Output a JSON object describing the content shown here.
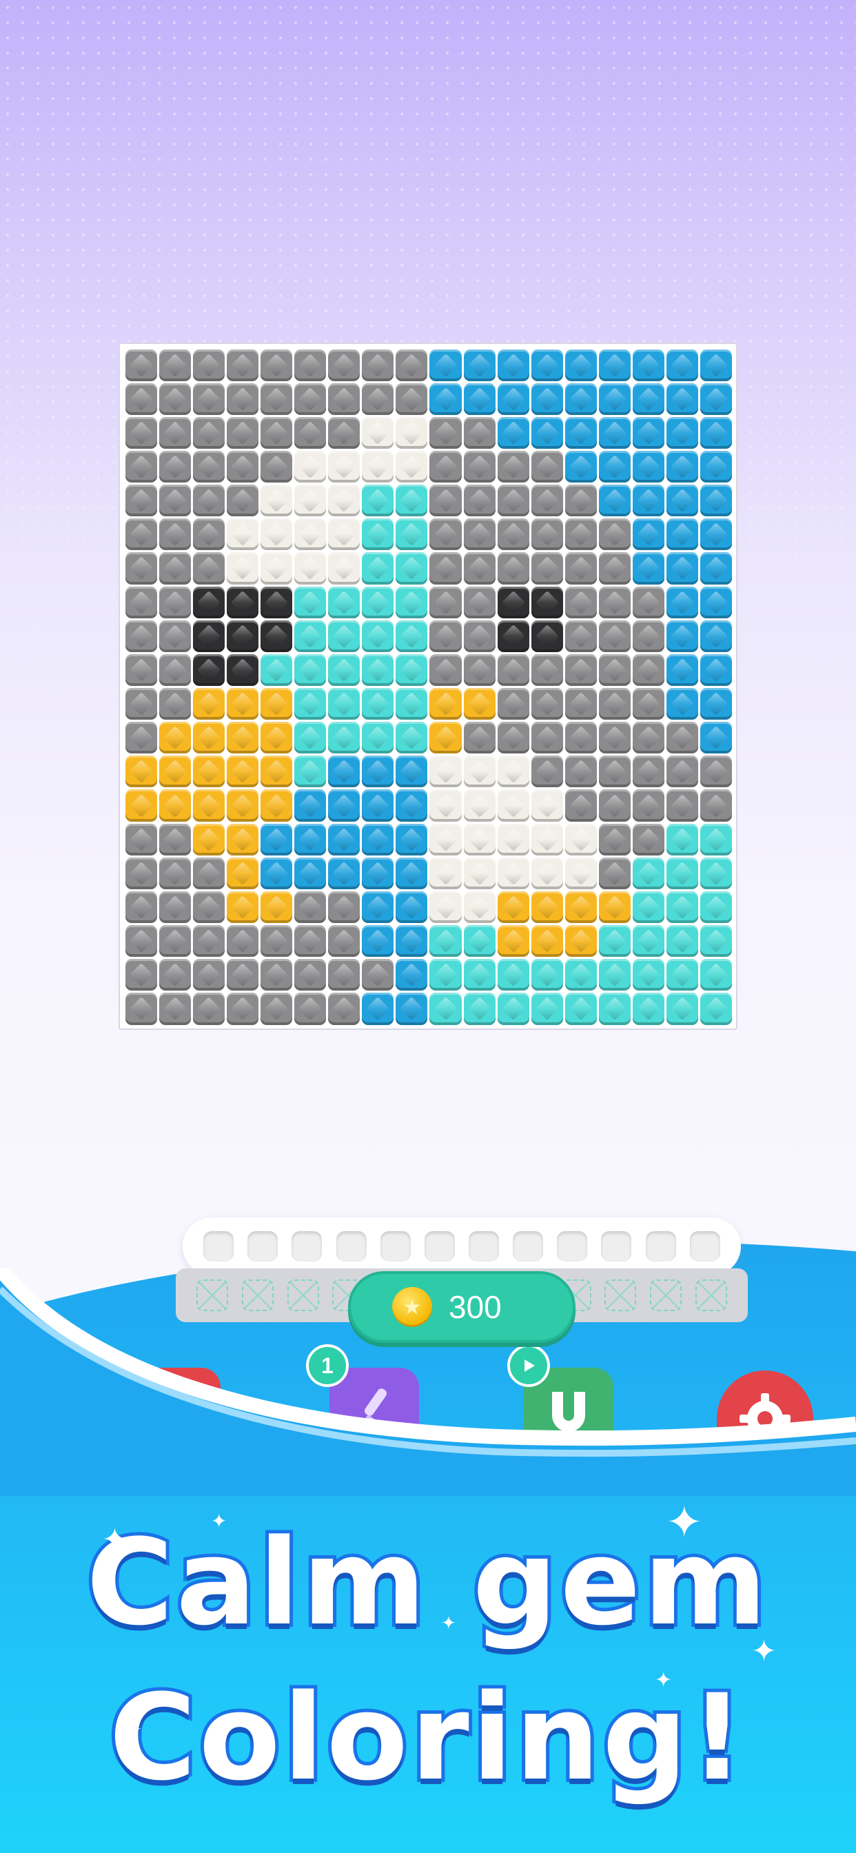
{
  "palette": {
    "G": "#8b8b8d",
    "B": "#22a2dd",
    "W": "#f2efe8",
    "C": "#4cdbd6",
    "K": "#2f2f31",
    "Y": "#f7b720"
  },
  "board": {
    "rows": [
      "GGGGGGGGGBBBBBBBBB",
      "GGGGGGGGGBBBBBBBBB",
      "GGGGGGGWWGGBBBBBBB",
      "GGGGGWWWWGGGGBBBBB",
      "GGGGWWWCCGGGGGBBBB",
      "GGGWWWWCCGGGGGGBBB",
      "GGGWWWWCCGGGGGGBBB",
      "GGKKKCCCCGGKKGGGBB",
      "GGKKKCCCCGGKKGGGBB",
      "GGKKCCCCCGGGGGGGBB",
      "GGYYYCCCCYYGGGGGBB",
      "GYYYYCCCCYGGGGGGGB",
      "YYYYYCBBBWWWGGGGGG",
      "YYYYYBBBBWWWWGGGGG",
      "GGYYBBBBBWWWWWGGCC",
      "GGGYBBBBBWWWWWGCCC",
      "GGGYYGGBBWWYYYYCCC",
      "GGGGGGGBBCCYYYCCCC",
      "GGGGGGGGBCCCCCCCCC",
      "GGGGGGGBBCCCCCCCCC"
    ]
  },
  "tray": {
    "top_slots": 12,
    "bottom_slots": 12
  },
  "coins": {
    "icon": "star-coin-icon",
    "count": "300"
  },
  "tools": {
    "brush_badge": "1",
    "brush_icon": "brush-icon",
    "magnet_badge_icon": "play-icon",
    "magnet_icon": "magnet-icon",
    "settings_icon": "gear-icon"
  },
  "headline": {
    "line1": "Calm gem",
    "line2": "Coloring!"
  }
}
